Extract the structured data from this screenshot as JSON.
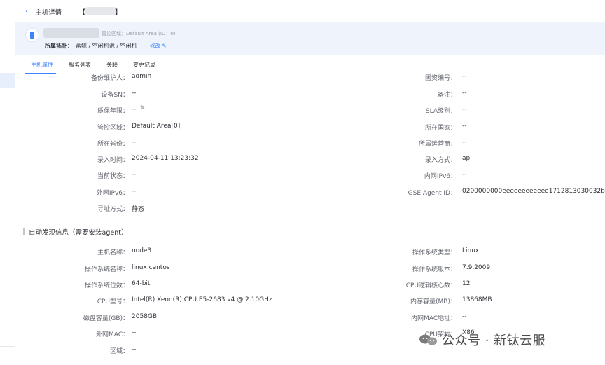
{
  "header": {
    "back_icon": "arrow-left-icon",
    "title": "主机详情",
    "title_bracket_open": "【",
    "title_bracket_close": "】"
  },
  "info_card": {
    "area_text": "管控区域：Default Area (ID：0)",
    "topology_label": "所属拓扑：",
    "topology_value": "蓝鲸 / 空闲机池 / 空闲机",
    "edit_label": "修改 ✎"
  },
  "tabs": [
    {
      "label": "主机属性",
      "active": true
    },
    {
      "label": "服务列表",
      "active": false
    },
    {
      "label": "关联",
      "active": false
    },
    {
      "label": "变更记录",
      "active": false
    }
  ],
  "attributes": {
    "left": [
      {
        "label": "备份维护人：",
        "value": "admin"
      },
      {
        "label": "设备SN：",
        "value": "--"
      },
      {
        "label": "质保年限：",
        "value": "--"
      },
      {
        "label": "管控区域：",
        "value": "Default Area[0]"
      },
      {
        "label": "所在省份：",
        "value": "--"
      },
      {
        "label": "录入时间：",
        "value": "2024-04-11 13:23:32"
      },
      {
        "label": "当前状态：",
        "value": "--"
      },
      {
        "label": "外网IPv6：",
        "value": "--"
      },
      {
        "label": "寻址方式：",
        "value": "静态"
      }
    ],
    "right": [
      {
        "label": "固资编号：",
        "value": "--"
      },
      {
        "label": "备注：",
        "value": "--"
      },
      {
        "label": "SLA级别：",
        "value": "--"
      },
      {
        "label": "所在国家：",
        "value": "--"
      },
      {
        "label": "所属运营商：",
        "value": "--"
      },
      {
        "label": "录入方式：",
        "value": "api"
      },
      {
        "label": "内网IPv6：",
        "value": "--"
      },
      {
        "label": "GSE Agent ID：",
        "value": "0200000000eeeeeeeeeeee1712813030032b"
      }
    ]
  },
  "auto_discovery": {
    "title": "自动发现信息（需要安装agent）",
    "left": [
      {
        "label": "主机名称：",
        "value": "node3"
      },
      {
        "label": "操作系统名称：",
        "value": "linux centos"
      },
      {
        "label": "操作系统位数：",
        "value": "64-bit"
      },
      {
        "label": "CPU型号：",
        "value": "Intel(R) Xeon(R) CPU E5-2683 v4 @ 2.10GHz"
      },
      {
        "label": "磁盘容量(GB)：",
        "value": "2058GB"
      },
      {
        "label": "外网MAC：",
        "value": "--"
      },
      {
        "label": "区域：",
        "value": "--"
      }
    ],
    "right": [
      {
        "label": "操作系统类型：",
        "value": "Linux"
      },
      {
        "label": "操作系统版本：",
        "value": "7.9.2009"
      },
      {
        "label": "CPU逻辑核心数：",
        "value": "12"
      },
      {
        "label": "内存容量(MB)：",
        "value": "13868MB"
      },
      {
        "label": "内网MAC地址：",
        "value": "--"
      },
      {
        "label": "CPU架构：",
        "value": "X86"
      }
    ]
  },
  "watermark": {
    "text": "公众号 · 新钛云服",
    "icon": "wechat-icon"
  },
  "colors": {
    "accent": "#3a84ff",
    "card_bg": "#eff4fc",
    "label": "#63656e",
    "text": "#313238"
  }
}
